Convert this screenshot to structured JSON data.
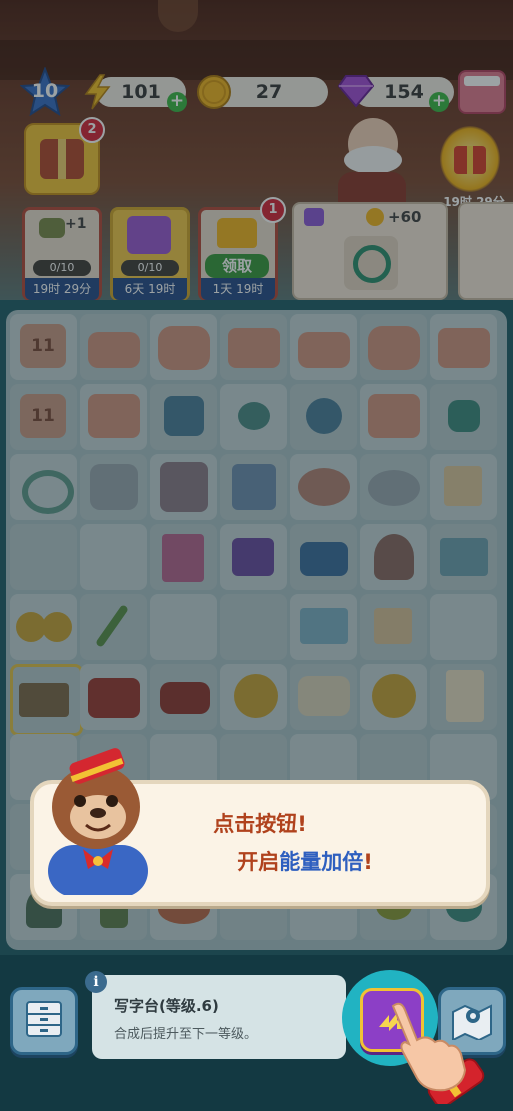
{
  "colors": {
    "energy_accent": "#2e5fbf",
    "dialog_text": "#b0421d",
    "progress_green": "#3eb848",
    "badge_red": "#d6283a"
  },
  "top_bar": {
    "level": "10",
    "energy": "101",
    "coins": "27",
    "gems": "154",
    "icons": [
      "star-icon",
      "lightning-icon",
      "coin-icon",
      "gem-icon",
      "shop-icon"
    ]
  },
  "notifications": {
    "chest_badge": "2",
    "gift_timer": "19时 29分"
  },
  "quests": [
    {
      "reward": "+1",
      "progress": "0/10",
      "timer": "19时 29分"
    },
    {
      "progress": "0/10",
      "timer": "6天 19时"
    },
    {
      "badge": "1",
      "button": "领取",
      "timer": "1天 19时"
    },
    {
      "reward": "+60"
    }
  ],
  "board": {
    "crate_level_a": "11",
    "crate_level_b": "11"
  },
  "dialog": {
    "line1": "点击按钮!",
    "line2_prefix": "开启",
    "line2_highlight": "能量加倍",
    "line2_suffix": "!"
  },
  "item_info": {
    "info_icon": "i",
    "name": "写字台(等级.6)",
    "description": "合成后提升至下一等级。"
  }
}
